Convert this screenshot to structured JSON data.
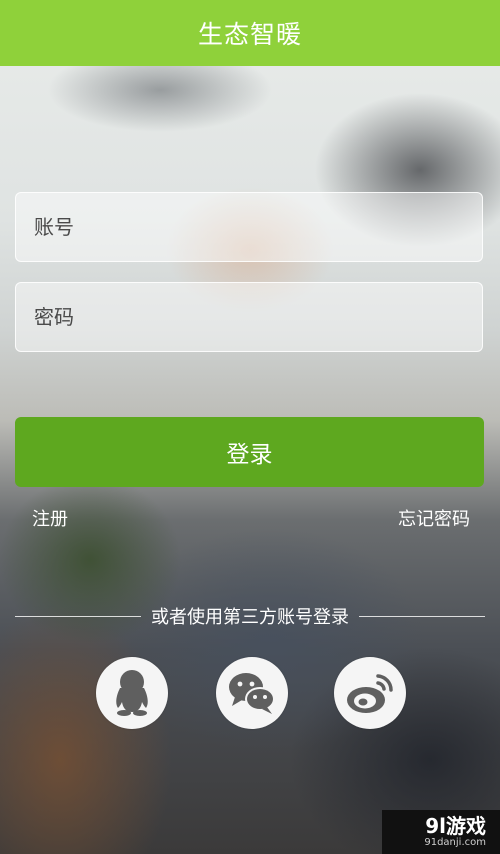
{
  "header": {
    "title": "生态智暖"
  },
  "form": {
    "account_placeholder": "账号",
    "password_placeholder": "密码",
    "login_label": "登录"
  },
  "links": {
    "register": "注册",
    "forgot_password": "忘记密码"
  },
  "third_party": {
    "label": "或者使用第三方账号登录",
    "providers": [
      {
        "name": "qq",
        "icon": "qq-penguin-icon"
      },
      {
        "name": "wechat",
        "icon": "wechat-icon"
      },
      {
        "name": "weibo",
        "icon": "weibo-icon"
      }
    ]
  },
  "watermark": {
    "main": "9l游戏",
    "sub": "91danji.com"
  },
  "colors": {
    "header_bg": "#8fd13a",
    "login_button_bg": "#5ea81f",
    "social_icon_fg": "#5f5f5f"
  }
}
